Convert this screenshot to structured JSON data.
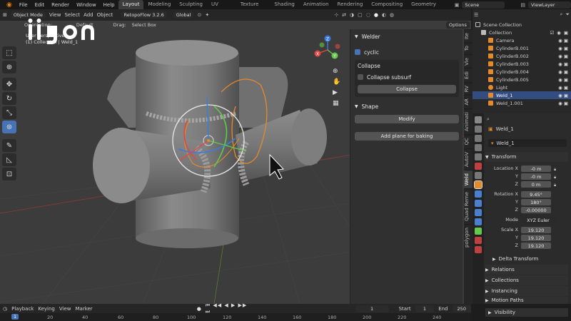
{
  "topbar": {
    "menus": [
      "File",
      "Edit",
      "Render",
      "Window",
      "Help"
    ],
    "workspaces": [
      "Layout",
      "Modeling",
      "Sculpting",
      "UV Editing",
      "Texture Paint",
      "Shading",
      "Animation",
      "Rendering",
      "Compositing",
      "Geometry Nodes"
    ],
    "active_workspace": "Layout",
    "scene": "Scene",
    "view_layer": "ViewLayer"
  },
  "viewport_header": {
    "mode": "Object Mode",
    "menus": [
      "View",
      "Select",
      "Add",
      "Object"
    ],
    "addon": "RetopoFlow 3.2.6",
    "transform_orientation": "Global",
    "orientation_label": "Orientation:",
    "orientation_value": "Default",
    "drag_label": "Drag:",
    "drag_value": "Select Box",
    "options": "Options"
  },
  "viewport_overlay": {
    "line1": "User Perspective",
    "line2": "(1) Collection | Weld_1"
  },
  "gizmo_axes": {
    "x": "X",
    "y": "Y",
    "z": "Z"
  },
  "n_panel": {
    "welder_title": "Welder",
    "cyclic_label": "cyclic",
    "cyclic_checked": true,
    "collapse_title": "Collapse",
    "collapse_subsurf_label": "Collapse subsurf",
    "collapse_subsurf_checked": false,
    "collapse_button": "Collapse",
    "shape_title": "Shape",
    "modify_button": "Modify",
    "add_plane_button": "Add plane for baking"
  },
  "side_tabs": [
    "Ite",
    "To",
    "Vie",
    "Edi",
    "RV",
    "AR",
    "Animati",
    "QC",
    "AutoV",
    "Weld",
    "Quad Reme",
    "polygon"
  ],
  "active_side_tab": "Weld",
  "outliner": {
    "title": "Scene Collection",
    "collection": "Collection",
    "items": [
      {
        "name": "Camera",
        "type": "camera"
      },
      {
        "name": "CylinderB.001",
        "type": "mesh"
      },
      {
        "name": "CylinderB.002",
        "type": "mesh"
      },
      {
        "name": "CylinderB.003",
        "type": "mesh"
      },
      {
        "name": "CylinderB.004",
        "type": "mesh"
      },
      {
        "name": "CylinderB.005",
        "type": "mesh"
      },
      {
        "name": "Light",
        "type": "light"
      },
      {
        "name": "Weld_1",
        "type": "curve",
        "selected": true
      },
      {
        "name": "Weld_1.001",
        "type": "curve"
      }
    ]
  },
  "properties": {
    "object_name": "Weld_1",
    "object_datablock": "Weld_1",
    "transform_title": "Transform",
    "location_label": "Location X",
    "location": [
      "-0 m",
      "-0 m",
      "0 m"
    ],
    "rotation_label": "Rotation X",
    "rotation": [
      "9.45°",
      "180°",
      "-0.00000"
    ],
    "mode_label": "Mode",
    "mode_value": "XYZ Euler",
    "scale_label": "Scale X",
    "scale": [
      "19.120",
      "19.120",
      "19.120"
    ],
    "axis_labels": [
      "Y",
      "Z"
    ],
    "delta_transform": "Delta Transform",
    "sections": [
      "Relations",
      "Collections",
      "Instancing",
      "Motion Paths",
      "Visibility"
    ]
  },
  "timeline": {
    "menus": [
      "Playback",
      "Keying",
      "View",
      "Marker"
    ],
    "current_frame": "1",
    "start_label": "Start",
    "start": "1",
    "end_label": "End",
    "end": "250",
    "ruler": [
      "1",
      "20",
      "40",
      "60",
      "80",
      "100",
      "120",
      "140",
      "160",
      "180",
      "200",
      "220",
      "240"
    ]
  },
  "colors": {
    "accent": "#4772b3",
    "viewport_bg": "#3c3c3c",
    "weld_orange": "#e58a2a"
  }
}
